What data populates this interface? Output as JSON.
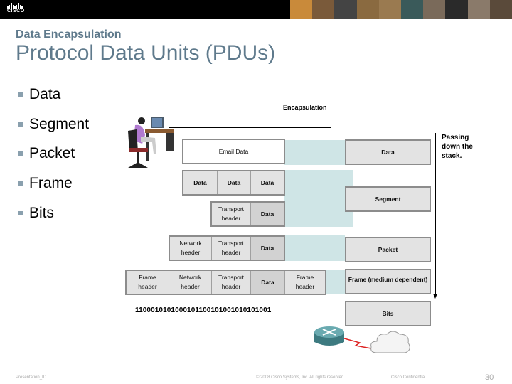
{
  "header": {
    "logo_text": "CISCO",
    "photo_colors": [
      "#c98a3a",
      "#7a5a3a",
      "#444",
      "#8a6a40",
      "#9a7a50",
      "#3a5a5a",
      "#7a6a5a",
      "#2a2a2a",
      "#8a7a6a",
      "#5a4a3a"
    ]
  },
  "slide": {
    "subtitle": "Data Encapsulation",
    "title": "Protocol Data Units (PDUs)",
    "bullets": [
      "Data",
      "Segment",
      "Packet",
      "Frame",
      "Bits"
    ]
  },
  "diagram": {
    "encapsulation_title": "Encapsulation",
    "passing_note": [
      "Passing",
      "down the",
      "stack."
    ],
    "email_data": "Email Data",
    "data_segments": [
      "Data",
      "Data",
      "Data"
    ],
    "segment_pdu": {
      "transport": [
        "Transport",
        "header"
      ],
      "data": "Data"
    },
    "packet_pdu": {
      "network": [
        "Network",
        "header"
      ],
      "transport": [
        "Transport",
        "header"
      ],
      "data": "Data"
    },
    "frame_pdu": {
      "frame_h": [
        "Frame",
        "header"
      ],
      "network": [
        "Network",
        "header"
      ],
      "transport": [
        "Transport",
        "header"
      ],
      "data": "Data",
      "frame_t": [
        "Frame",
        "header"
      ]
    },
    "bits_string": "1100010101000101100101001010101001",
    "pdu_labels": [
      "Data",
      "Segment",
      "Packet",
      "Frame (medium dependent)",
      "Bits"
    ]
  },
  "footer": {
    "presentation_id": "Presentation_ID",
    "copyright": "© 2008 Cisco Systems, Inc. All rights reserved.",
    "confidential": "Cisco Confidential",
    "page_number": "30"
  }
}
